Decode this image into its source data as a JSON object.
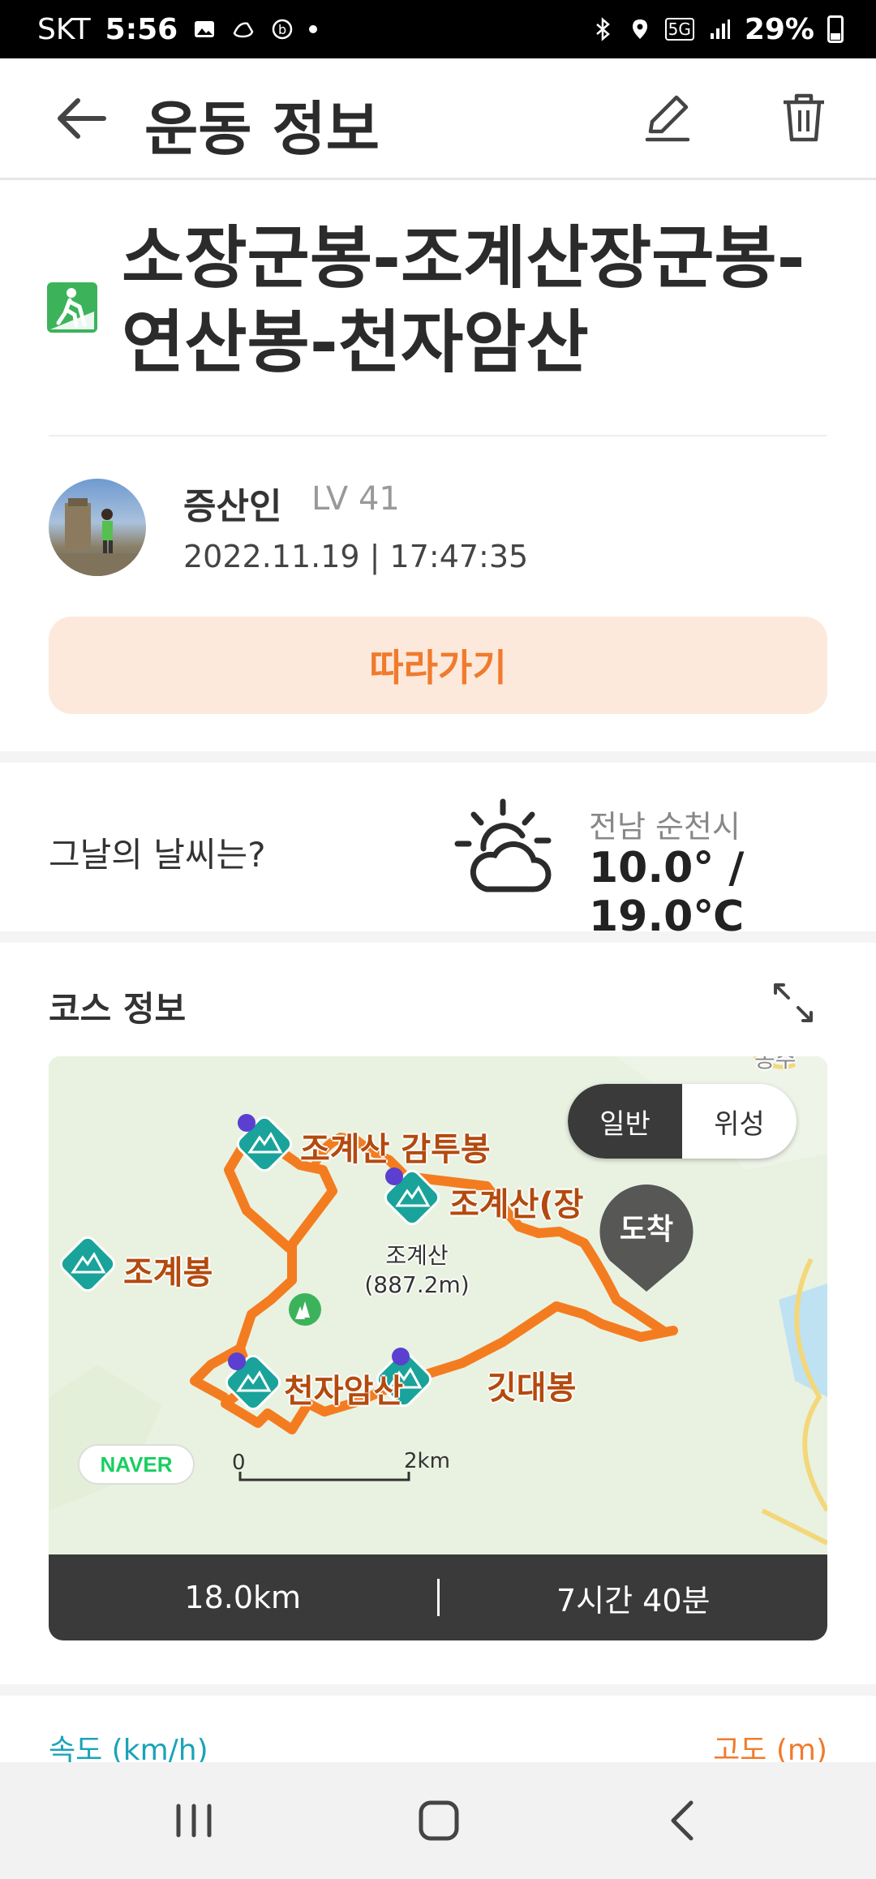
{
  "status_bar": {
    "carrier": "SKT",
    "time": "5:56",
    "battery": "29%",
    "network": "5G"
  },
  "app_bar": {
    "title": "운동 정보",
    "back_icon": "back-arrow-icon",
    "edit_icon": "pencil-icon",
    "delete_icon": "trash-icon"
  },
  "activity": {
    "type_icon": "hiking-icon",
    "title": "소장군봉-조계산장군봉-연산봉-천자암산"
  },
  "user": {
    "name": "증산인",
    "level": "LV 41",
    "datetime": "2022.11.19 | 17:47:35"
  },
  "follow_button": {
    "label": "따라가기"
  },
  "weather": {
    "question": "그날의 날씨는?",
    "icon": "partly-cloudy-icon",
    "location": "전남 순천시",
    "temperature": "10.0° / 19.0℃"
  },
  "course": {
    "label": "코스 정보",
    "expand_icon": "expand-icon",
    "map_mode": {
      "normal": "일반",
      "satellite": "위성",
      "selected": "일반"
    },
    "peaks": [
      {
        "name": "조계산 감투봉"
      },
      {
        "name": "조계산(장"
      },
      {
        "name": "조계봉"
      },
      {
        "name": "천자암산"
      },
      {
        "name": "깃대봉"
      }
    ],
    "peak_sub": {
      "name": "조계산",
      "elev": "(887.2m)"
    },
    "corner_text": "송주",
    "arrival_label": "도착",
    "map_provider": "NAVER",
    "scale_start": "0",
    "scale_end": "2km",
    "distance": "18.0km",
    "duration": "7시간 40분"
  },
  "charts": {
    "speed_label": "속도 (km/h)",
    "altitude_label": "고도 (m)"
  },
  "colors": {
    "accent_orange": "#f07b2d",
    "follow_bg": "#fde9dc",
    "hiking_green": "#3cb35b",
    "speed_teal": "#19a3b8",
    "route": "#f07b2d"
  }
}
